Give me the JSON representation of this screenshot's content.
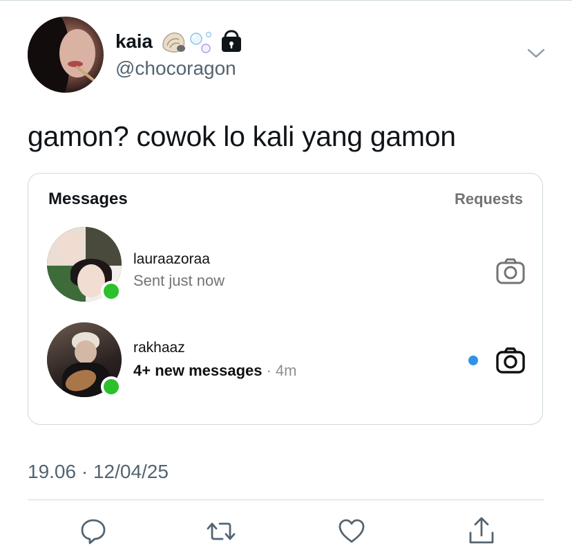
{
  "tweet": {
    "display_name": "kaia",
    "name_emojis": [
      "shell-emoji",
      "bubbles-emoji",
      "lock-icon"
    ],
    "handle": "@chocoragon",
    "text": "gamon? cowok lo kali yang gamon",
    "timestamp": "19.06 · 12/04/25"
  },
  "embedded_screenshot": {
    "title": "Messages",
    "requests_label": "Requests",
    "conversations": [
      {
        "username": "lauraazoraa",
        "status": "Sent just now",
        "online": true,
        "unread": false,
        "icon": "camera-icon"
      },
      {
        "username": "rakhaaz",
        "status": "4+ new messages",
        "separator": "·",
        "time": "4m",
        "online": true,
        "unread": true,
        "icon": "camera-icon"
      }
    ]
  },
  "actions": [
    "reply-icon",
    "retweet-icon",
    "like-icon",
    "share-icon"
  ],
  "colors": {
    "text": "#0f1419",
    "secondary": "#536471",
    "border": "#cfd9de",
    "online_green": "#2bc02c",
    "unread_blue": "#2f92ed"
  }
}
